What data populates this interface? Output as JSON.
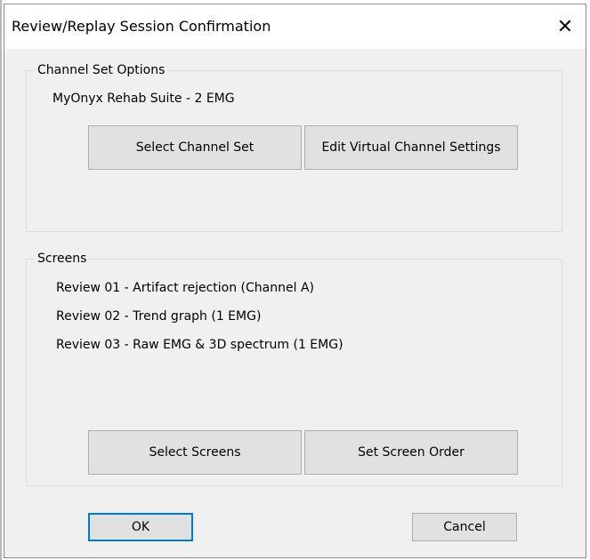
{
  "dialog": {
    "title": "Review/Replay Session Confirmation",
    "close_glyph": "✕"
  },
  "channel_set": {
    "group_label": "Channel Set Options",
    "current": "MyOnyx Rehab Suite - 2 EMG",
    "select_button": "Select Channel Set",
    "edit_button": "Edit Virtual Channel Settings"
  },
  "screens": {
    "group_label": "Screens",
    "items": [
      "Review 01 - Artifact rejection (Channel A)",
      "Review 02 - Trend graph (1 EMG)",
      "Review 03 - Raw EMG & 3D spectrum (1 EMG)"
    ],
    "select_button": "Select Screens",
    "order_button": "Set Screen Order"
  },
  "footer": {
    "ok": "OK",
    "cancel": "Cancel"
  },
  "colors": {
    "accent": "#0078d7",
    "button_face": "#e1e1e1",
    "dialog_bg": "#f0f0f0"
  }
}
